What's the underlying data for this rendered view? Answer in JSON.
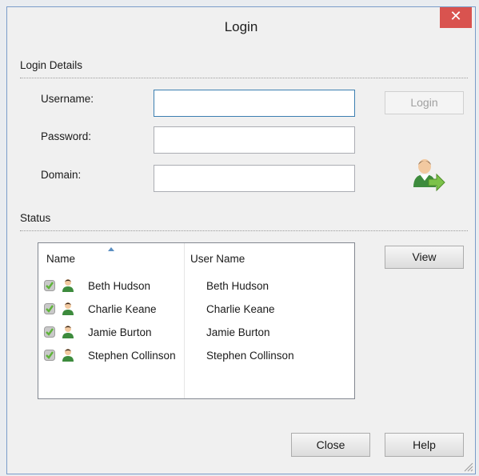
{
  "window": {
    "title": "Login",
    "close_glyph": "✕"
  },
  "login_details": {
    "heading": "Login Details",
    "username_label": "Username:",
    "username_value": "",
    "password_label": "Password:",
    "password_value": "",
    "domain_label": "Domain:",
    "domain_value": "",
    "login_button": "Login"
  },
  "status": {
    "heading": "Status",
    "columns": {
      "name": "Name",
      "user_name": "User Name"
    },
    "rows": [
      {
        "name": "Beth Hudson",
        "user_name": "Beth Hudson",
        "icon": "check-icon"
      },
      {
        "name": "Charlie Keane",
        "user_name": "Charlie Keane",
        "icon": "check-icon"
      },
      {
        "name": "Jamie Burton",
        "user_name": "Jamie Burton",
        "icon": "check-icon"
      },
      {
        "name": "Stephen Collinson",
        "user_name": "Stephen Collinson",
        "icon": "check-icon"
      }
    ],
    "view_button": "View"
  },
  "footer": {
    "close_button": "Close",
    "help_button": "Help"
  },
  "colors": {
    "close_red": "#d9534f",
    "focus_border": "#3c7fb1",
    "check_green": "#6bbf47"
  }
}
